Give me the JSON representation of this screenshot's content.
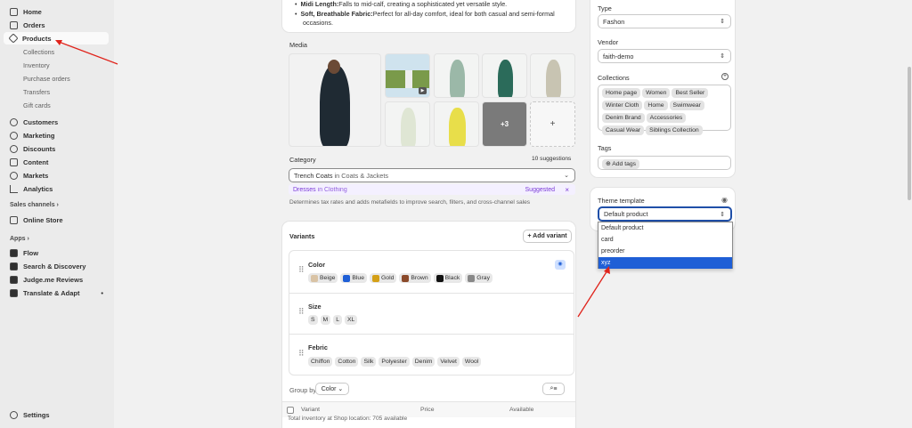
{
  "nav": {
    "home": "Home",
    "orders": "Orders",
    "products": "Products",
    "collections": "Collections",
    "inventory": "Inventory",
    "purchase_orders": "Purchase orders",
    "transfers": "Transfers",
    "gift_cards": "Gift cards",
    "customers": "Customers",
    "marketing": "Marketing",
    "discounts": "Discounts",
    "content": "Content",
    "markets": "Markets",
    "analytics": "Analytics",
    "sales_channels": "Sales channels",
    "online_store": "Online Store",
    "apps": "Apps",
    "flow": "Flow",
    "search_discovery": "Search & Discovery",
    "judgeme": "Judge.me Reviews",
    "translate": "Translate & Adapt",
    "settings": "Settings"
  },
  "description": {
    "bullet1_bold": "Midi Length:",
    "bullet1_text": "Falls to mid-calf, creating a sophisticated yet versatile style.",
    "bullet2_bold": "Soft, Breathable Fabric:",
    "bullet2_text": "Perfect for all-day comfort, ideal for both casual and semi-formal occasions."
  },
  "media": {
    "title": "Media",
    "more": "+3",
    "add": "+"
  },
  "category": {
    "title": "Category",
    "suggestions": "10 suggestions",
    "value": "Trench Coats",
    "value_suffix": "in Coats & Jackets",
    "suggested_name": "Dresses",
    "suggested_suffix": "in Clothing",
    "suggested_badge": "Suggested",
    "close": "×",
    "help": "Determines tax rates and adds metafields to improve search, filters, and cross-channel sales"
  },
  "variants": {
    "title": "Variants",
    "add_button": "+ Add variant",
    "color_label": "Color",
    "colors": [
      {
        "name": "Beige",
        "hex": "#d9c3a5"
      },
      {
        "name": "Blue",
        "hex": "#1f5fd6"
      },
      {
        "name": "Gold",
        "hex": "#d4a017"
      },
      {
        "name": "Brown",
        "hex": "#8b4a2b"
      },
      {
        "name": "Black",
        "hex": "#111111"
      },
      {
        "name": "Gray",
        "hex": "#888888"
      }
    ],
    "size_label": "Size",
    "sizes": [
      "S",
      "M",
      "L",
      "XL"
    ],
    "fabric_label": "Febric",
    "fabrics": [
      "Chiffon",
      "Cotton",
      "Silk",
      "Polyester",
      "Denim",
      "Velvet",
      "Wool"
    ],
    "group_by": "Group by",
    "group_value": "Color",
    "col_variant": "Variant",
    "col_price": "Price",
    "col_available": "Available",
    "inventory_note": "Total inventory at Shop location: 705 available"
  },
  "organization": {
    "type_label": "Type",
    "type_value": "Fashon",
    "vendor_label": "Vendor",
    "vendor_value": "faith-demo",
    "collections_label": "Collections",
    "collections": [
      "Home page",
      "Women",
      "Best Seller",
      "Winter Cloth",
      "Home",
      "Swimwear",
      "Denim Brand",
      "Accessories",
      "Casual Wear",
      "Siblings Collection"
    ],
    "tags_label": "Tags",
    "add_tags": "Add tags"
  },
  "theme": {
    "label": "Theme template",
    "selected": "Default product",
    "options": [
      "Default product",
      "card",
      "preorder",
      "xyz"
    ],
    "highlighted": "xyz"
  }
}
